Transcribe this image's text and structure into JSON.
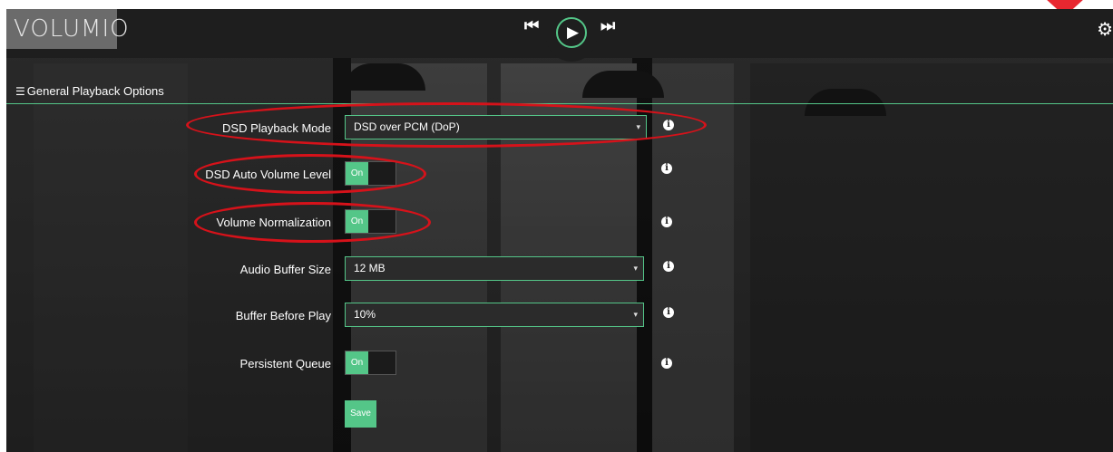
{
  "app": {
    "logo_text": "VOLUMIO"
  },
  "transport": {
    "prev_glyph": "⏮",
    "play_glyph": "▶",
    "next_glyph": "⏭",
    "accent": "#54c688"
  },
  "header": {
    "settings_icon": "⚙"
  },
  "section": {
    "icon": "☰",
    "title": "General Playback Options"
  },
  "settings": {
    "dsd_playback_mode": {
      "label": "DSD Playback Mode",
      "value": "DSD over PCM (DoP)"
    },
    "dsd_auto_volume": {
      "label": "DSD Auto Volume Level",
      "state": "On"
    },
    "volume_normalization": {
      "label": "Volume Normalization",
      "state": "On"
    },
    "audio_buffer_size": {
      "label": "Audio Buffer Size",
      "value": "12 MB"
    },
    "buffer_before_play": {
      "label": "Buffer Before Play",
      "value": "10%"
    },
    "persistent_queue": {
      "label": "Persistent Queue",
      "state": "On"
    }
  },
  "info_glyph": "i",
  "caret_glyph": "▾",
  "save_label": "Save",
  "colors": {
    "accent": "#54c688",
    "annotation": "#d6121a"
  }
}
